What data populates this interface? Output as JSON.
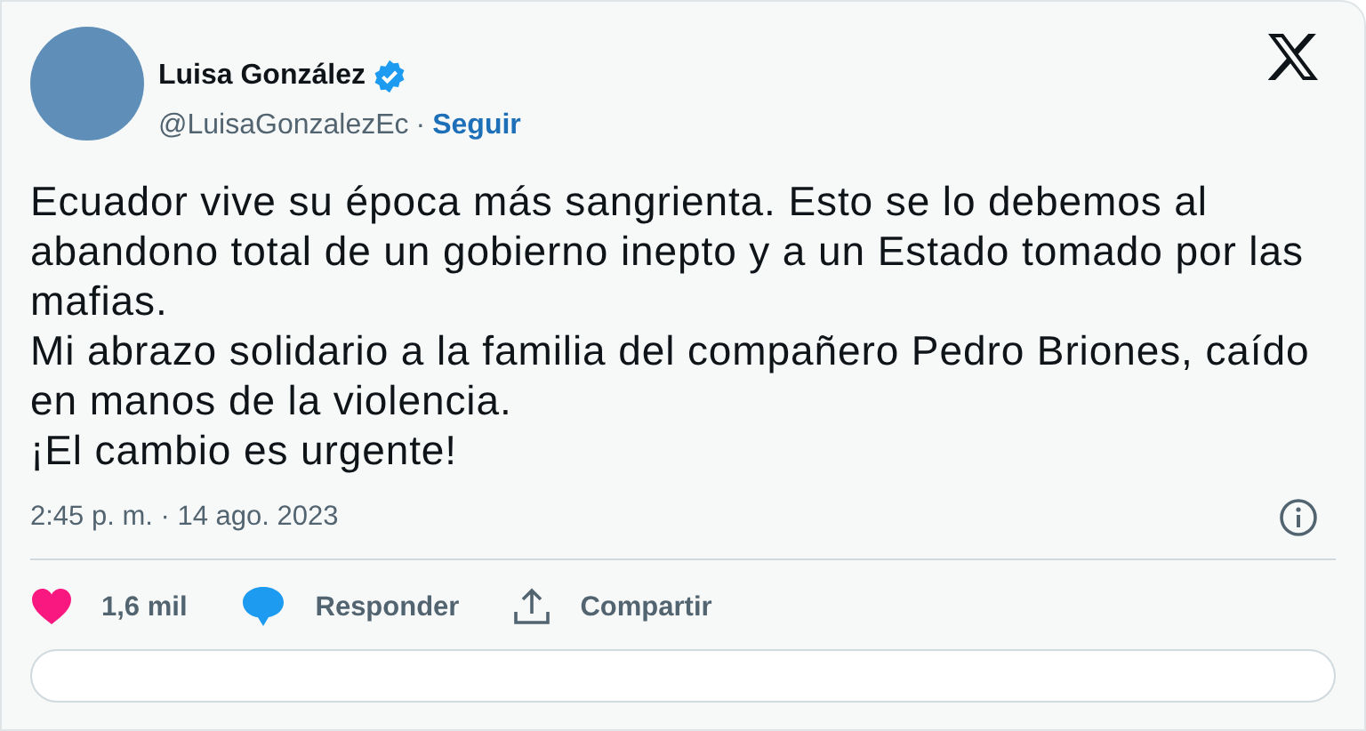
{
  "author": {
    "name": "Luisa González",
    "verified": true,
    "handle": "@LuisaGonzalezEc",
    "separator": "·",
    "follow": "Seguir"
  },
  "text": [
    "Ecuador vive su época más sangrienta. Esto se lo debemos al abandono total de un gobierno inepto y a un Estado tomado por las mafias.",
    "Mi abrazo solidario a la familia del compañero Pedro Briones, caído en manos de la violencia.",
    "¡El cambio es urgente!"
  ],
  "timestamp": "2:45 p. m. · 14 ago. 2023",
  "actions": [
    {
      "kind": "like",
      "label": "1,6 mil"
    },
    {
      "kind": "reply",
      "label": "Responder"
    },
    {
      "kind": "share",
      "label": "Compartir"
    }
  ]
}
